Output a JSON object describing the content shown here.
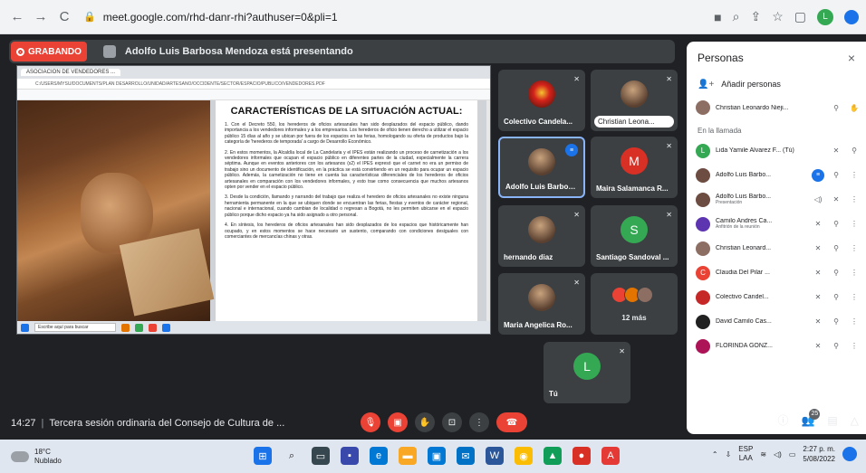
{
  "browser": {
    "url": "meet.google.com/rhd-danr-rhi?authuser=0&pli=1",
    "back": "←",
    "forward": "→",
    "reload": "C",
    "profile_initial": "L"
  },
  "recording": {
    "label": "GRABANDO",
    "presenting_text": "Adolfo Luis Barbosa Mendoza está presentando"
  },
  "shared_screen": {
    "tab_label": "ASOCIACION DE VENDEDORES ...",
    "address": "C:/USERS/MYSU/DOCUMENTS/PLAN DESARROLLO/UNIDAD/ARTESANO/OCCIDENTE/SECTOR/ESPACIO/PUBLICO/VENDEDORES.PDF",
    "title": "CARACTERÍSTICAS DE LA SITUACIÓN ACTUAL:",
    "paragraphs": [
      "1. Con el Decreto 550, los herederos de oficios artesanales han sido desplazados del espacio público, dando importancia a los vendedores informales y a los empresarios. Los herederos de oficio tienen derecho a utilizar el espacio público 15 días al año y se ubican por fuera de los espacios en las ferias, homologando su oferta de productos bajo la categoría de 'herederos de temporada' a cargo de Desarrollo Económico.",
      "2. En estos momentos, la Alcaldía local de La Candelaria y el IPES están realizando un proceso de carnetización a los vendedores informales que ocupan el espacio público en diferentes partes de la ciudad, especialmente la carrera séptima. Aunque en eventos anteriores con los artesanos (s2) el IPES expresó que el carnet no era un permiso de trabajo sino un documento de identificación, en la práctica se está convirtiendo en un requisito para ocupar un espacio público. Además, la carnetización no tiene en cuenta las características diferenciales de los herederos de oficios artesanales en comparación con los vendedores informales, y esto trae como consecuencia que muchos artesanos opten por vender en el espacio público.",
      "3. Desde la condición, llamando y narrando del trabajo que realiza el heredero de oficios artesanales no existe ninguna herramienta permanente en la que se ubiquen donde se encuentran las ferias, fiestas y eventos de carácter regional, nacional e internacional, cuando cambian de localidad o regresan a Bogotá, no les permiten ubicarse en el espacio público porque dicho espacio ya ha sido asignado a otro personal.",
      "4. En síntesis, los herederos de oficios artesanales han sido desplazados de los espacios que históricamente han ocupado, y en estos momentos se hace necesario un sustento, comparando con condiciones desiguales con comerciantes de mercancías chinas y otras."
    ],
    "taskbar_search": "Escribe aquí para buscar"
  },
  "tiles": [
    {
      "name": "Colectivo Candela...",
      "avatar": "crest",
      "muted": true,
      "active": false
    },
    {
      "name": "Christian Leona...",
      "avatar": "photo",
      "muted": true,
      "active": false,
      "boxed": true
    },
    {
      "name": "Adolfo Luis Barbos...",
      "avatar": "photo",
      "muted": false,
      "active": true
    },
    {
      "name": "Maira Salamanca R...",
      "avatar": "letter",
      "initial": "M",
      "color": "#d93025",
      "muted": true,
      "active": false
    },
    {
      "name": "hernando diaz",
      "avatar": "photo",
      "muted": true,
      "active": false
    },
    {
      "name": "Santiago Sandoval ...",
      "avatar": "letter",
      "initial": "S",
      "color": "#34a853",
      "muted": true,
      "active": false
    },
    {
      "name": "Maria Angelica Ro...",
      "avatar": "photo",
      "muted": true,
      "active": false
    },
    {
      "name": "12 más",
      "avatar": "group",
      "muted": false,
      "active": false
    },
    {
      "name": "Tú",
      "avatar": "letter",
      "initial": "L",
      "color": "#34a853",
      "muted": true,
      "active": false
    }
  ],
  "people_panel": {
    "title": "Personas",
    "close": "×",
    "add_label": "Añadir personas",
    "section_label": "En la llamada",
    "people": [
      {
        "name": "Christian Leonardo Nieji...",
        "sub": "",
        "av": "photo",
        "color": "#8d6e63"
      },
      {
        "name": "Lida Yamile Alvarez F... (Tú)",
        "sub": "",
        "av": "letter",
        "initial": "L",
        "color": "#34a853"
      },
      {
        "name": "Adolfo Luis Barbo...",
        "sub": "",
        "av": "photo",
        "color": "#6d4c41",
        "speaking": true
      },
      {
        "name": "Adolfo Luis Barbo...",
        "sub": "Presentación",
        "av": "photo",
        "color": "#6d4c41"
      },
      {
        "name": "Camilo Andres Ca...",
        "sub": "Anfitrión de la reunión",
        "av": "photo",
        "color": "#5e35b1"
      },
      {
        "name": "Christian Leonard...",
        "sub": "",
        "av": "photo",
        "color": "#8d6e63"
      },
      {
        "name": "Claudia Del Pilar ...",
        "sub": "",
        "av": "letter",
        "initial": "C",
        "color": "#ea4335"
      },
      {
        "name": "Colectivo Candel...",
        "sub": "",
        "av": "photo",
        "color": "#c62828"
      },
      {
        "name": "David Camilo Cas...",
        "sub": "",
        "av": "photo",
        "color": "#212121"
      },
      {
        "name": "FLORINDA GONZ...",
        "sub": "",
        "av": "photo",
        "color": "#ad1457"
      }
    ]
  },
  "callbar": {
    "time": "14:27",
    "title": "Tercera sesión ordinaria del Consejo de Cultura de ...",
    "people_count": "25"
  },
  "taskbar": {
    "temp": "18°C",
    "weather": "Nublado",
    "lang": "ESP",
    "lang2": "LAA",
    "time": "2:27 p. m.",
    "date": "5/08/2022"
  },
  "colors": {
    "meet_bg": "#202124",
    "tile_bg": "#3c4043",
    "record_red": "#ea4335",
    "active_blue": "#8ab4f8"
  }
}
